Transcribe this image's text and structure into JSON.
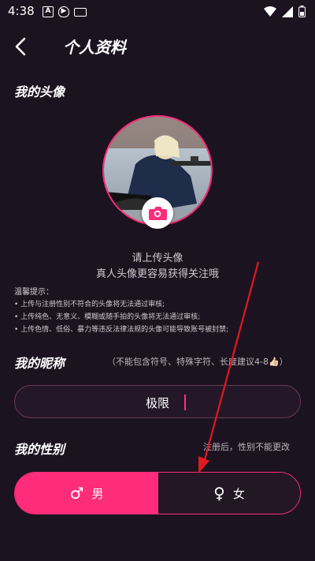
{
  "status_bar": {
    "time": "4:38"
  },
  "header": {
    "title": "个人资料"
  },
  "avatar_section": {
    "title": "我的头像",
    "hint_line1": "请上传头像",
    "hint_line2": "真人头像更容易获得关注哦"
  },
  "tips": {
    "title": "温馨提示：",
    "items": [
      "• 上传与注册性别不符合的头像将无法通过审核;",
      "• 上传纯色、无意义、模糊或随手拍的头像将无法通过审核;",
      "• 上传色情、低俗、暴力等违反法律法规的头像可能导致账号被封禁;"
    ]
  },
  "nickname": {
    "title": "我的昵称",
    "note": "（不能包含符号、特殊字符、长度建议4-8👍🏻）",
    "value": "极限"
  },
  "gender": {
    "title": "我的性别",
    "note": "注册后，性别不能更改",
    "male_label": "男",
    "female_label": "女",
    "selected": "男"
  },
  "colors": {
    "accent": "#ff2c7a",
    "background": "#1c1320",
    "annotation_arrow": "#e0191f"
  }
}
